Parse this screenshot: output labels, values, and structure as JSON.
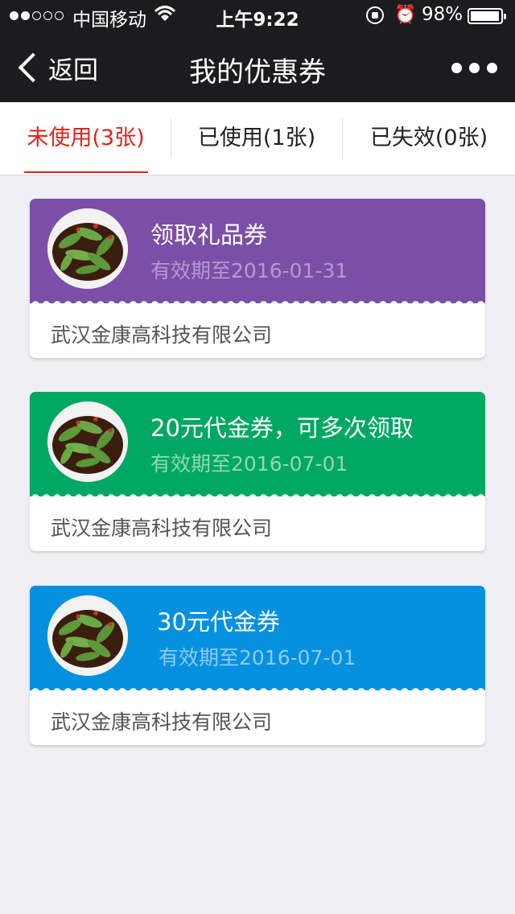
{
  "status": {
    "carrier": "中国移动",
    "time": "上午9:22",
    "battery": "98%",
    "battery_level": 0.98,
    "signal_bars": 2
  },
  "nav": {
    "back_label": "返回",
    "title": "我的优惠券",
    "more_icon": "more-dots-icon"
  },
  "tabs": [
    {
      "label": "未使用(3张)",
      "active": true
    },
    {
      "label": "已使用(1张)",
      "active": false
    },
    {
      "label": "已失效(0张)",
      "active": false
    }
  ],
  "colors": {
    "accent": "#e2231a",
    "purple": "#7b4fa8",
    "green": "#00a864",
    "blue": "#0591e0"
  },
  "coupons": [
    {
      "name": "领取礼品券",
      "expiry": "有效期至2016-01-31",
      "company": "武汉金康高科技有限公司",
      "color": "#7b4fa8",
      "expiry_color": "#b49ad0"
    },
    {
      "name": "20元代金券，可多次领取",
      "expiry": "有效期至2016-07-01",
      "company": "武汉金康高科技有限公司",
      "color": "#00a864",
      "expiry_color": "#8fd8b3"
    },
    {
      "name": "30元代金券",
      "expiry": "有效期至2016-07-01",
      "company": "武汉金康高科技有限公司",
      "color": "#0591e0",
      "expiry_color": "#8fcbf0"
    }
  ]
}
